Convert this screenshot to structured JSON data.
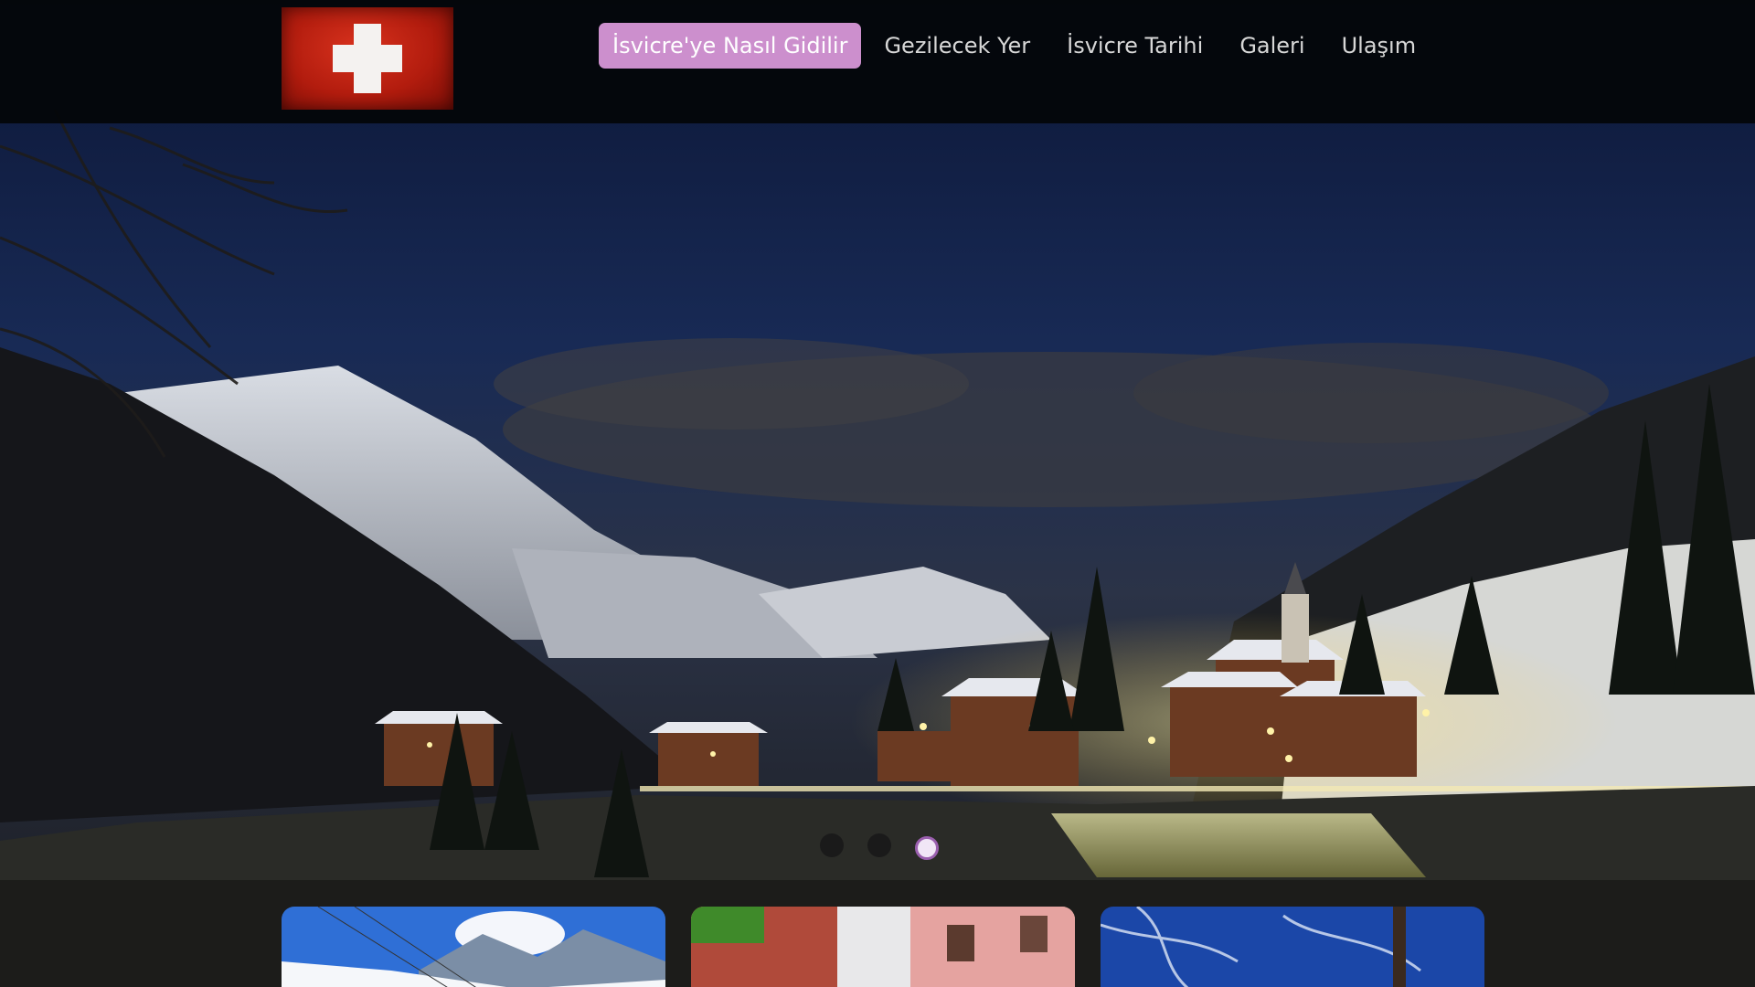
{
  "page": {
    "logo_icon": "swiss-flag",
    "accent_color": "#cc8fcd"
  },
  "nav": {
    "items": [
      {
        "label": "İsvicre'ye Nasıl Gidilir",
        "active": true
      },
      {
        "label": "Gezilecek Yer",
        "active": false
      },
      {
        "label": "İsvicre Tarihi",
        "active": false
      },
      {
        "label": "Galeri",
        "active": false
      },
      {
        "label": "Ulaşım",
        "active": false
      }
    ]
  },
  "slider": {
    "slide_count": 3,
    "active_slide": 3
  },
  "cards": [
    {
      "scene": "snowy-mountains"
    },
    {
      "scene": "town-street"
    },
    {
      "scene": "winter-forest"
    }
  ]
}
